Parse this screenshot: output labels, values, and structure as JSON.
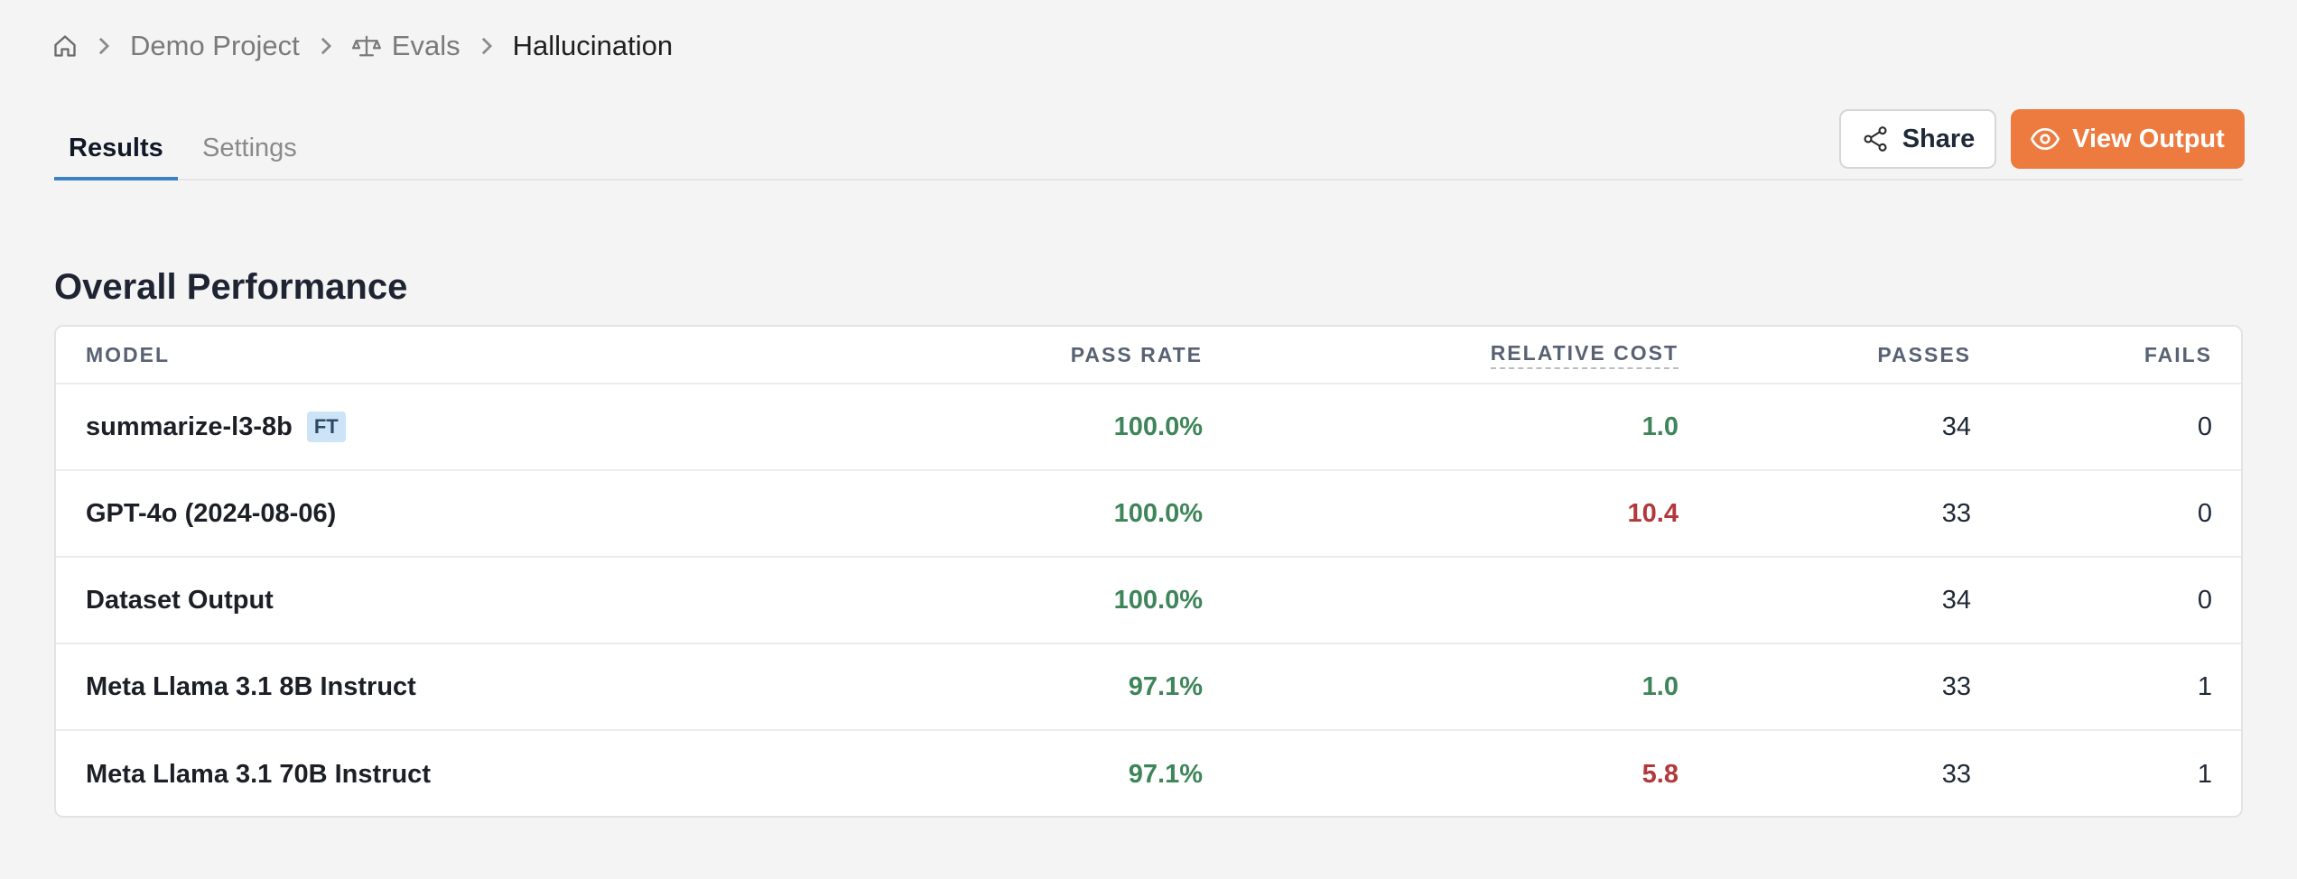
{
  "breadcrumb": {
    "items": [
      {
        "label": "Demo Project"
      },
      {
        "label": "Evals"
      },
      {
        "label": "Hallucination"
      }
    ]
  },
  "tabs": [
    {
      "label": "Results",
      "active": true
    },
    {
      "label": "Settings",
      "active": false
    }
  ],
  "actions": {
    "share_label": "Share",
    "view_output_label": "View Output"
  },
  "section": {
    "title": "Overall Performance"
  },
  "table": {
    "columns": [
      "MODEL",
      "PASS RATE",
      "RELATIVE COST",
      "PASSES",
      "FAILS"
    ],
    "rows": [
      {
        "model": "summarize-l3-8b",
        "badge": "FT",
        "pass_rate": "100.0%",
        "relative_cost": "1.0",
        "cost_status": "good",
        "passes": "34",
        "fails": "0"
      },
      {
        "model": "GPT-4o (2024-08-06)",
        "badge": "",
        "pass_rate": "100.0%",
        "relative_cost": "10.4",
        "cost_status": "bad",
        "passes": "33",
        "fails": "0"
      },
      {
        "model": "Dataset Output",
        "badge": "",
        "pass_rate": "100.0%",
        "relative_cost": "",
        "cost_status": "none",
        "passes": "34",
        "fails": "0"
      },
      {
        "model": "Meta Llama 3.1 8B Instruct",
        "badge": "",
        "pass_rate": "97.1%",
        "relative_cost": "1.0",
        "cost_status": "good",
        "passes": "33",
        "fails": "1"
      },
      {
        "model": "Meta Llama 3.1 70B Instruct",
        "badge": "",
        "pass_rate": "97.1%",
        "relative_cost": "5.8",
        "cost_status": "bad",
        "passes": "33",
        "fails": "1"
      }
    ]
  },
  "colors": {
    "accent_orange": "#ed7a3f",
    "tab_underline": "#3b82c4",
    "good_green": "#3e8559",
    "bad_red": "#b3383b",
    "badge_bg": "#cde3f6"
  },
  "icons": {
    "home": "home-icon",
    "chevron": "chevron-right-icon",
    "evals": "scale-icon",
    "share": "share-icon",
    "view": "eye-icon"
  }
}
